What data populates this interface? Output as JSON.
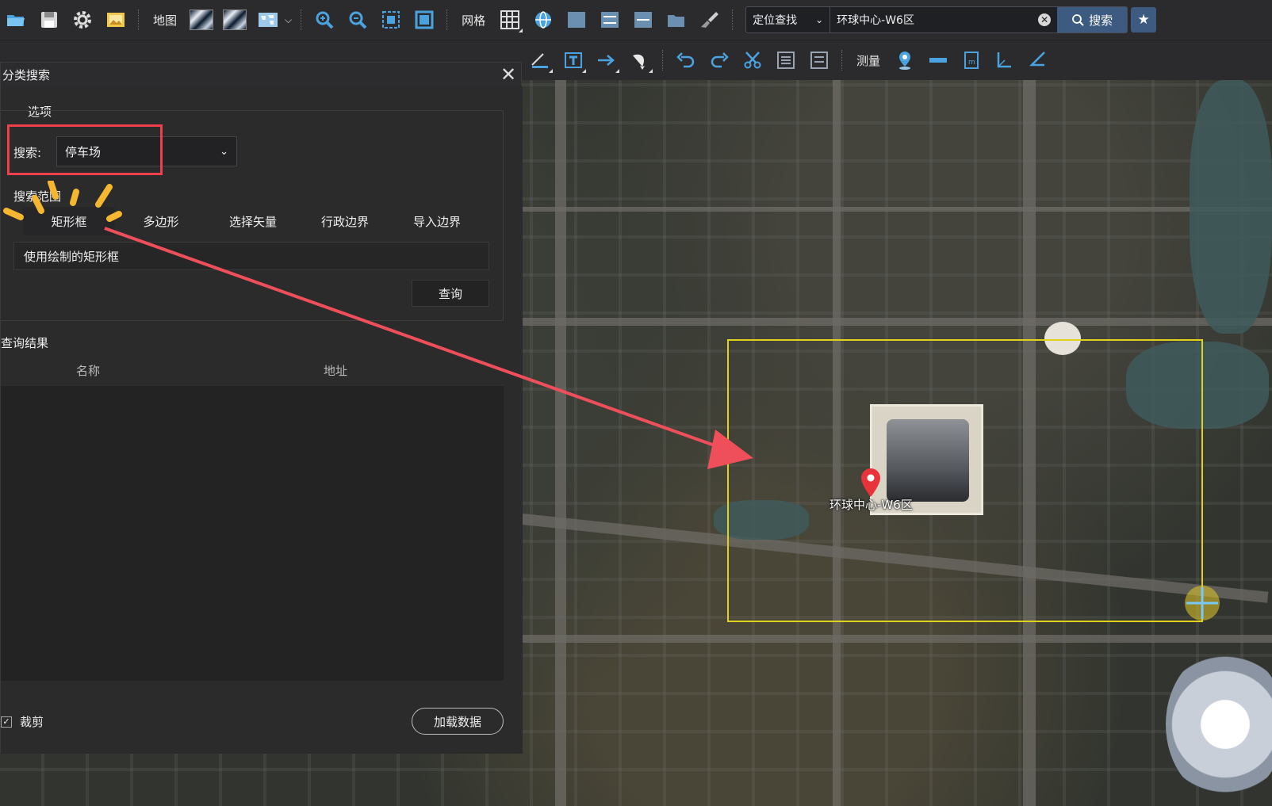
{
  "toolbar1": {
    "map_label": "地图",
    "grid_label": "网格",
    "locate_mode": "定位查找",
    "locate_value": "环球中心-W6区",
    "search_label": "搜索"
  },
  "toolbar2": {
    "measure_label": "测量"
  },
  "map": {
    "pin_label": "环球中心-W6区",
    "selection_color": "#e0d21c",
    "pin_color": "#e8333a"
  },
  "dialog": {
    "title": "分类搜索",
    "options_group": "选项",
    "search_field_label": "搜索:",
    "search_category": "停车场",
    "range_label": "搜索范围",
    "tabs": [
      "矩形框",
      "多边形",
      "选择矢量",
      "行政边界",
      "导入边界"
    ],
    "active_tab": "矩形框",
    "range_info": "使用绘制的矩形框",
    "query_button": "查询",
    "results_label": "查询结果",
    "columns": [
      "名称",
      "地址"
    ],
    "crop_label": "裁剪",
    "crop_checked": true,
    "load_button": "加载数据"
  },
  "annotation": {
    "highlight_color": "#ef3f4a",
    "arrow_color": "#ef4f5a",
    "sparkle_color": "#f5b731"
  },
  "icons": [
    "folder-open-icon",
    "save-icon",
    "gear-icon",
    "image-icon",
    "zoom-in-icon",
    "zoom-out-icon",
    "zoom-extent-icon",
    "full-extent-icon",
    "grid-icon",
    "globe-icon",
    "brush-icon",
    "undo-icon",
    "redo-icon",
    "scissors-icon",
    "location-pin-icon",
    "ruler-icon",
    "area-icon",
    "angle-icon",
    "star-icon"
  ]
}
